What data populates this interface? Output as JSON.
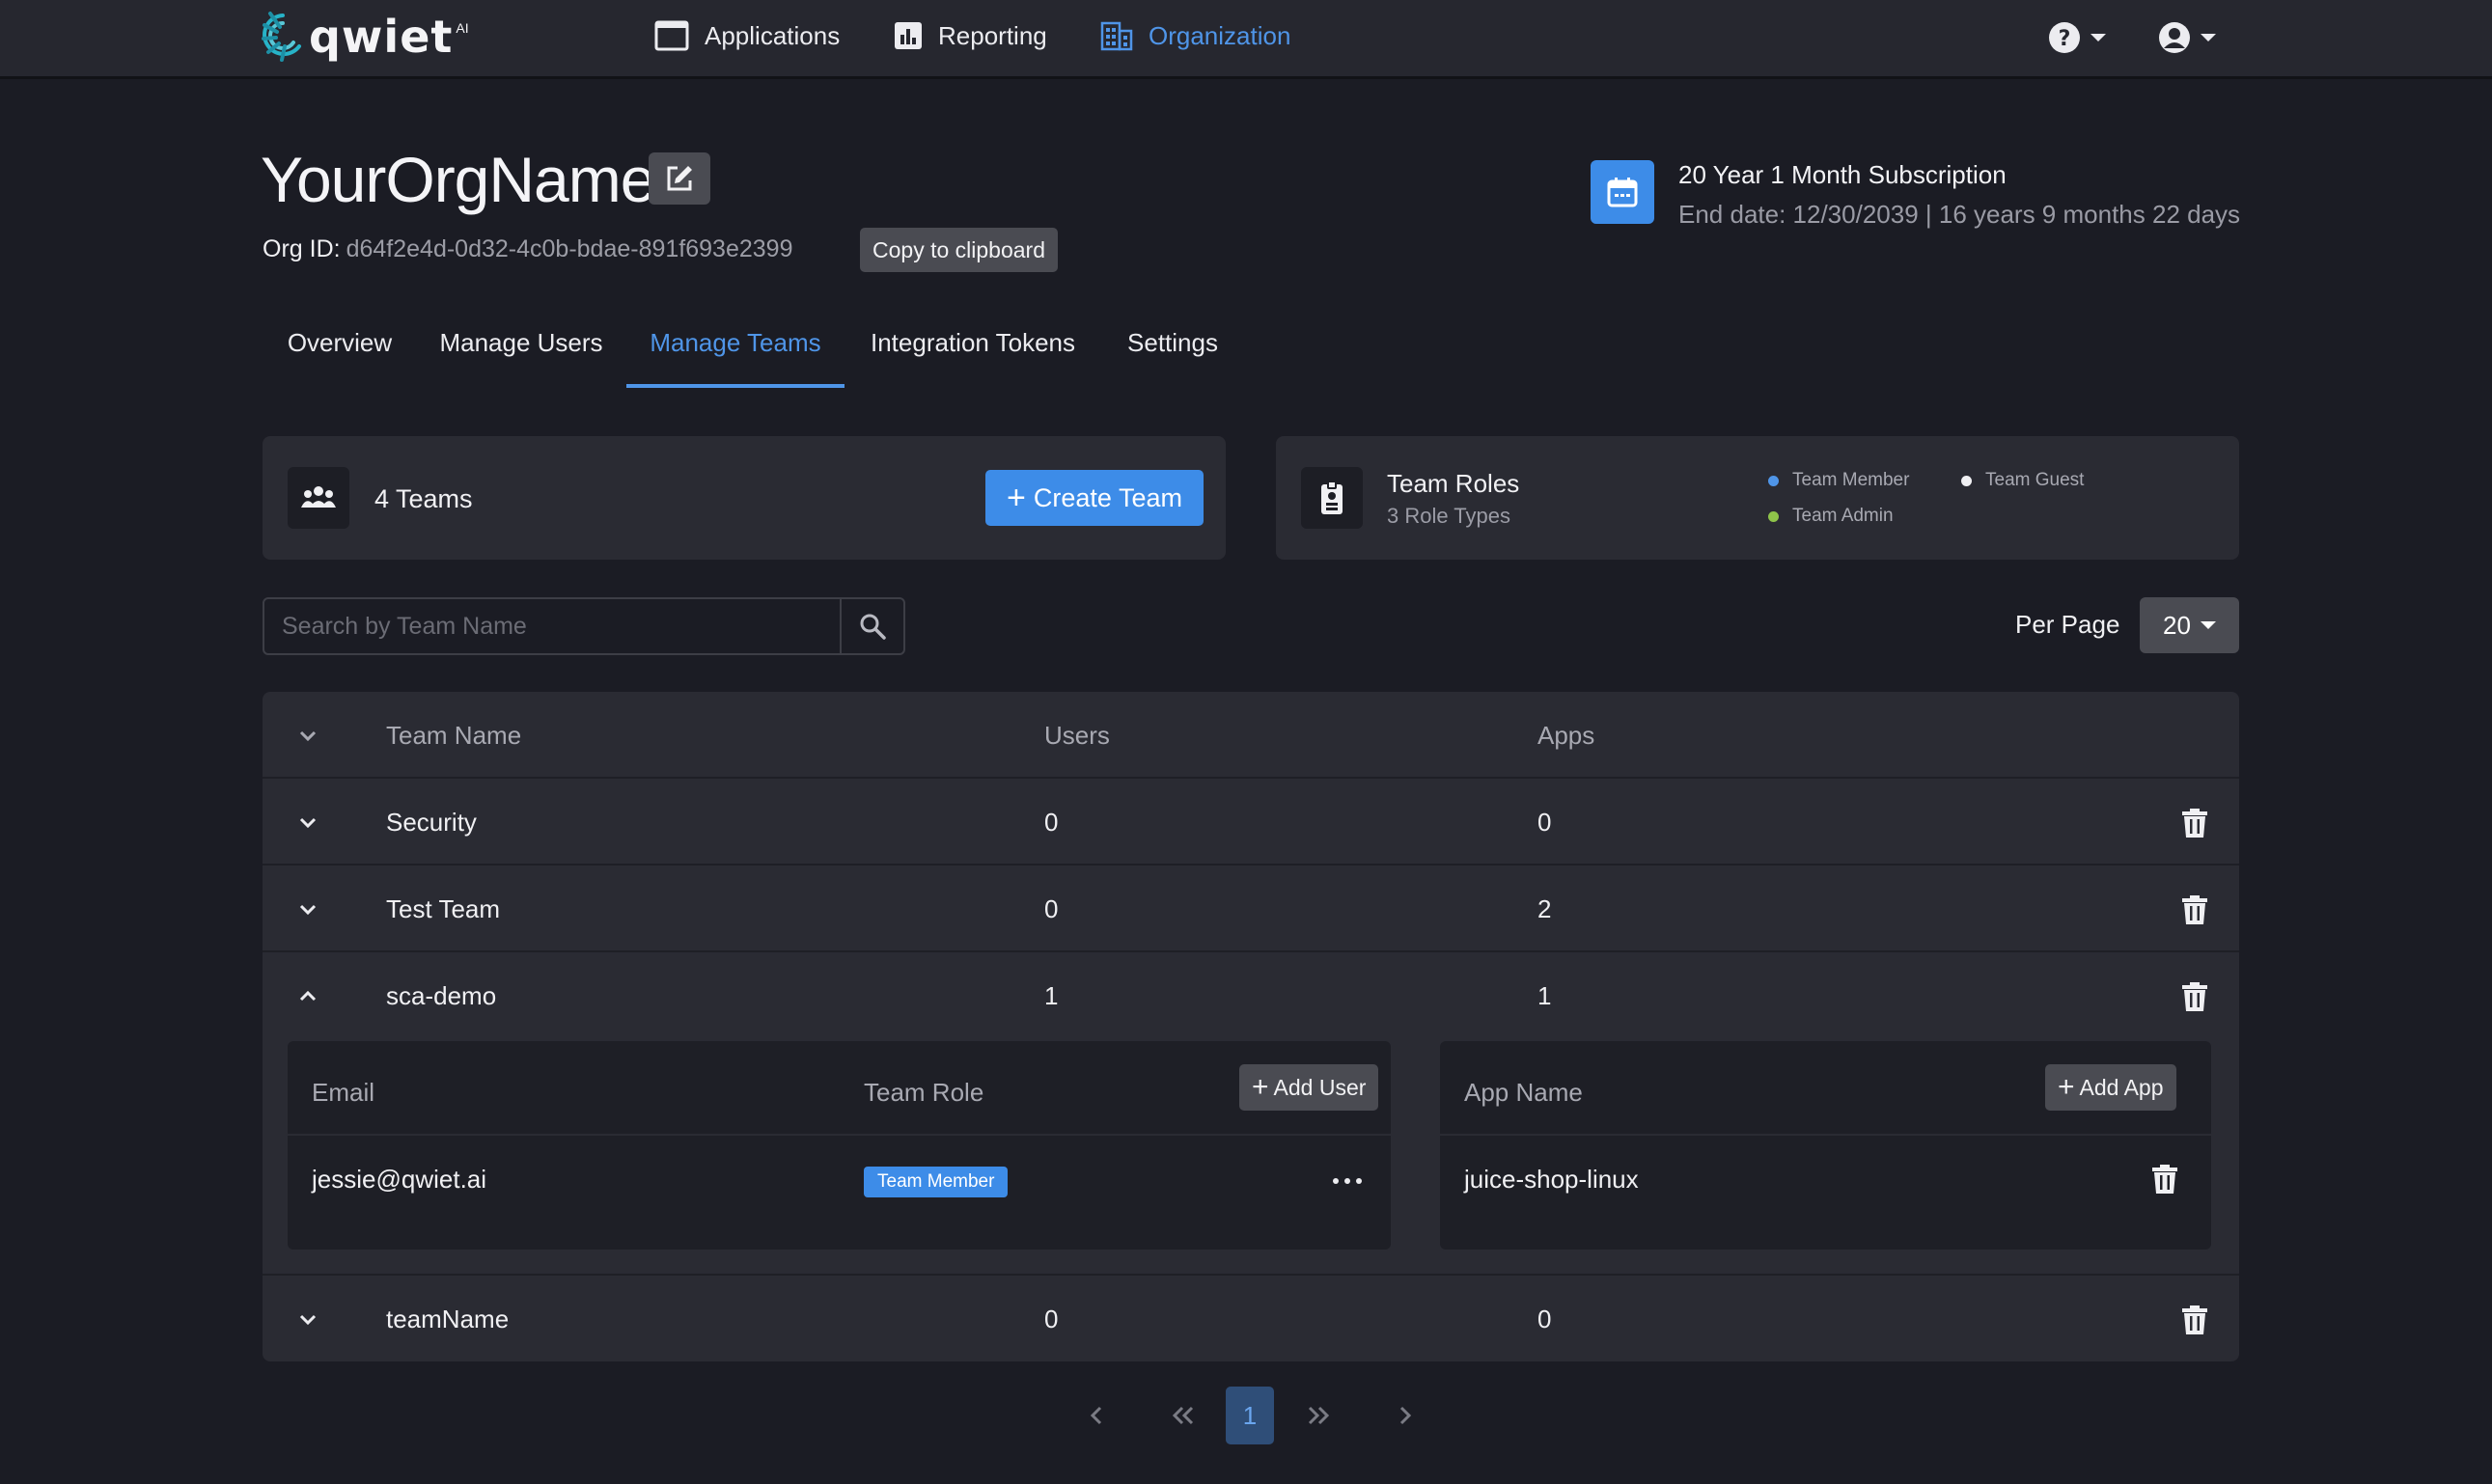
{
  "nav": {
    "brand": "qwiet",
    "brand_suffix": "AI",
    "items": [
      {
        "label": "Applications",
        "icon": "window-icon"
      },
      {
        "label": "Reporting",
        "icon": "bar-chart-icon"
      },
      {
        "label": "Organization",
        "icon": "building-icon",
        "active": true
      }
    ]
  },
  "org": {
    "name": "YourOrgName",
    "id_label": "Org ID:",
    "id_value": "d64f2e4d-0d32-4c0b-bdae-891f693e2399",
    "copy_label": "Copy to clipboard"
  },
  "subscription": {
    "title": "20 Year 1 Month Subscription",
    "end": "End date: 12/30/2039 | 16 years 9 months 22 days"
  },
  "tabs": [
    {
      "label": "Overview"
    },
    {
      "label": "Manage Users"
    },
    {
      "label": "Manage Teams",
      "active": true
    },
    {
      "label": "Integration Tokens"
    },
    {
      "label": "Settings"
    }
  ],
  "teams_card": {
    "count_label": "4 Teams",
    "create_label": "Create Team"
  },
  "roles_card": {
    "title": "Team Roles",
    "subtitle": "3 Role Types",
    "legend": [
      {
        "label": "Team Member",
        "color": "#4f95e8"
      },
      {
        "label": "Team Guest",
        "color": "#f0f0f3"
      },
      {
        "label": "Team Admin",
        "color": "#8ec34a"
      }
    ]
  },
  "search": {
    "placeholder": "Search by Team Name"
  },
  "per_page": {
    "label": "Per Page",
    "value": "20"
  },
  "table": {
    "headers": {
      "name": "Team Name",
      "users": "Users",
      "apps": "Apps"
    },
    "rows": [
      {
        "name": "Security",
        "users": "0",
        "apps": "0",
        "expanded": false
      },
      {
        "name": "Test Team",
        "users": "0",
        "apps": "2",
        "expanded": false
      },
      {
        "name": "sca-demo",
        "users": "1",
        "apps": "1",
        "expanded": true
      },
      {
        "name": "teamName",
        "users": "0",
        "apps": "0",
        "expanded": false
      }
    ],
    "expanded_detail": {
      "users_headers": {
        "email": "Email",
        "role": "Team Role"
      },
      "add_user_label": "Add User",
      "user_email": "jessie@qwiet.ai",
      "user_role": "Team Member",
      "apps_header": "App Name",
      "add_app_label": "Add App",
      "app_name": "juice-shop-linux"
    }
  },
  "pagination": {
    "current": "1"
  },
  "colors": {
    "accent": "#3d8ce8",
    "background": "#1b1c24",
    "card": "#2a2b33"
  }
}
